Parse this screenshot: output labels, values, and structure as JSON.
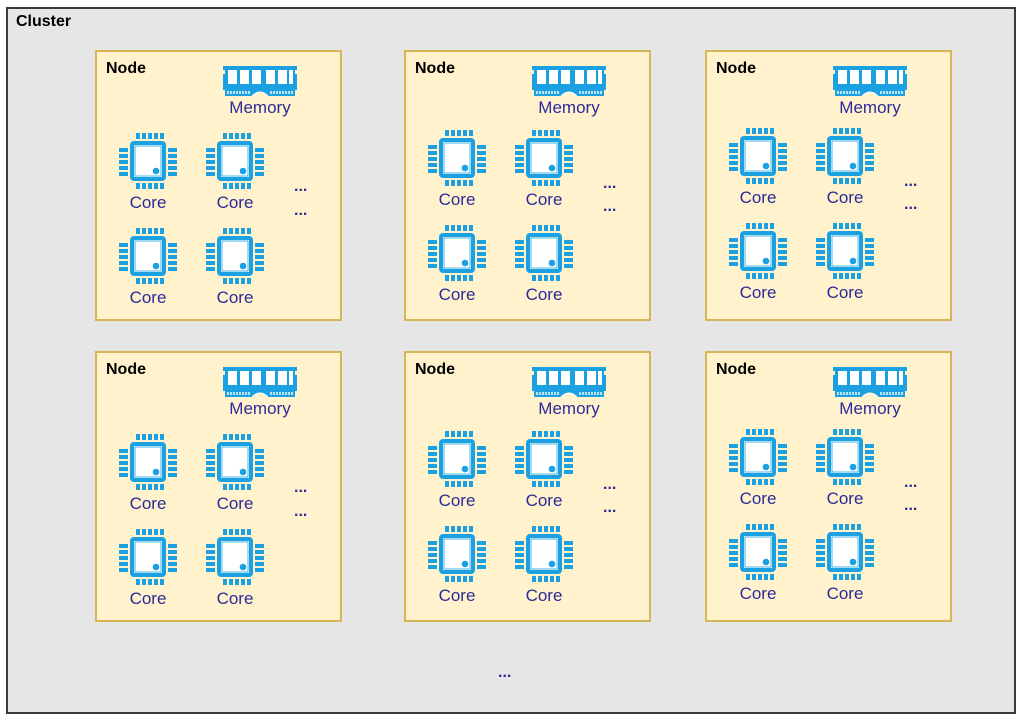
{
  "cluster": {
    "title": "Cluster",
    "more_label": "...",
    "nodes": [
      {
        "title": "Node",
        "memory_label": "Memory",
        "cores": [
          "Core",
          "Core",
          "Core",
          "Core"
        ],
        "more_cores": [
          "...",
          "..."
        ]
      },
      {
        "title": "Node",
        "memory_label": "Memory",
        "cores": [
          "Core",
          "Core",
          "Core",
          "Core"
        ],
        "more_cores": [
          "...",
          "..."
        ]
      },
      {
        "title": "Node",
        "memory_label": "Memory",
        "cores": [
          "Core",
          "Core",
          "Core",
          "Core"
        ],
        "more_cores": [
          "...",
          "..."
        ]
      },
      {
        "title": "Node",
        "memory_label": "Memory",
        "cores": [
          "Core",
          "Core",
          "Core",
          "Core"
        ],
        "more_cores": [
          "...",
          "..."
        ]
      },
      {
        "title": "Node",
        "memory_label": "Memory",
        "cores": [
          "Core",
          "Core",
          "Core",
          "Core"
        ],
        "more_cores": [
          "...",
          "..."
        ]
      },
      {
        "title": "Node",
        "memory_label": "Memory",
        "cores": [
          "Core",
          "Core",
          "Core",
          "Core"
        ],
        "more_cores": [
          "...",
          "..."
        ]
      }
    ]
  },
  "colors": {
    "cluster_bg": "#e6e6e6",
    "cluster_border": "#3a3a3a",
    "node_bg": "#fff2cc",
    "node_border": "#d6b656",
    "icon": "#1ba1e2",
    "label": "#2b2b9a"
  },
  "icons": {
    "memory": "memory-icon",
    "core": "cpu-icon"
  }
}
